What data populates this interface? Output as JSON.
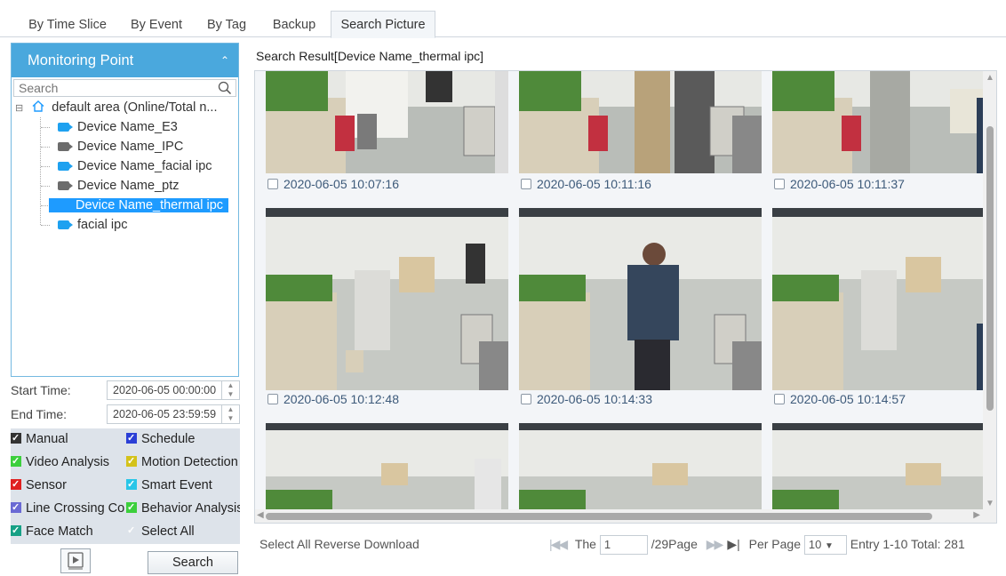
{
  "tabs": [
    {
      "label": "By Time Slice"
    },
    {
      "label": "By Event"
    },
    {
      "label": "By Tag"
    },
    {
      "label": "Backup"
    },
    {
      "label": "Search Picture"
    }
  ],
  "monitoring": {
    "title": "Monitoring Point",
    "search_placeholder": "Search",
    "tree": {
      "area": "default area (Online/Total n...",
      "devices": [
        {
          "label": "Device Name_E3",
          "status": "online"
        },
        {
          "label": "Device Name_IPC",
          "status": "offline"
        },
        {
          "label": "Device Name_facial ipc",
          "status": "online"
        },
        {
          "label": "Device Name_ptz",
          "status": "offline"
        },
        {
          "label": "Device Name_thermal ipc",
          "status": "selected"
        },
        {
          "label": "facial ipc",
          "status": "online"
        }
      ]
    }
  },
  "time": {
    "start_label": "Start Time:",
    "start_value": "2020-06-05 00:00:00",
    "end_label": "End Time:",
    "end_value": "2020-06-05 23:59:59"
  },
  "event_types": [
    {
      "label": "Manual",
      "color": "#333333"
    },
    {
      "label": "Schedule",
      "color": "#2b3fd6"
    },
    {
      "label": "Video Analysis",
      "color": "#3ccf3c"
    },
    {
      "label": "Motion Detection",
      "color": "#d4c21a"
    },
    {
      "label": "Sensor",
      "color": "#e02020"
    },
    {
      "label": "Smart Event",
      "color": "#28c6e8"
    },
    {
      "label": "Line Crossing Co",
      "color": "#6a6ad4"
    },
    {
      "label": "Behavior Analysis",
      "color": "#3ccf3c"
    },
    {
      "label": "Face Match",
      "color": "#16a085"
    },
    {
      "label": "Select All",
      "color": "#ffffff"
    }
  ],
  "buttons": {
    "search": "Search"
  },
  "result": {
    "title": "Search Result[Device Name_thermal ipc]",
    "pictures": [
      {
        "time": "2020-06-05 10:07:16"
      },
      {
        "time": "2020-06-05 10:11:16"
      },
      {
        "time": "2020-06-05 10:11:37"
      },
      {
        "time": "2020-06-05 10:12:48"
      },
      {
        "time": "2020-06-05 10:14:33"
      },
      {
        "time": "2020-06-05 10:14:57"
      },
      {
        "time": ""
      },
      {
        "time": ""
      },
      {
        "time": ""
      }
    ]
  },
  "actions": {
    "select_all": "Select All",
    "reverse": "Reverse",
    "download": "Download"
  },
  "pager": {
    "the": "The",
    "page": "1",
    "total_pages": "/29Page",
    "per_page": "Per Page",
    "per_page_value": "10",
    "entry": "Entry",
    "summary": "1-10 Total: 281"
  }
}
